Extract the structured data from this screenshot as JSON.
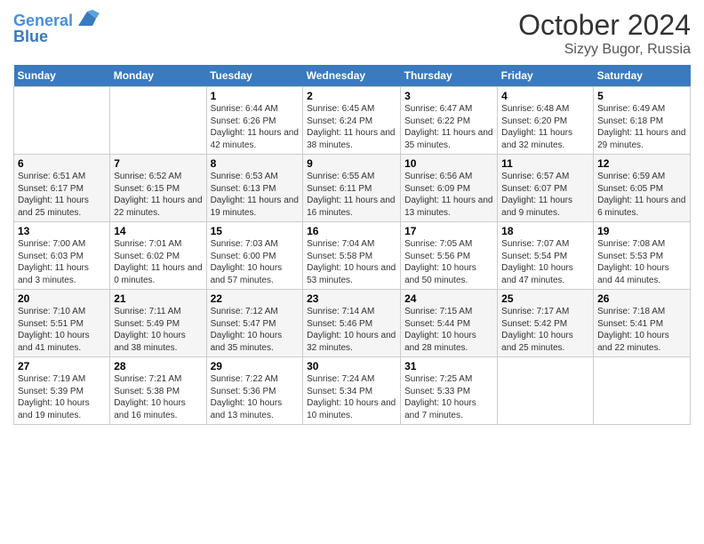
{
  "header": {
    "logo_line1": "General",
    "logo_line2": "Blue",
    "month": "October 2024",
    "location": "Sizyy Bugor, Russia"
  },
  "weekdays": [
    "Sunday",
    "Monday",
    "Tuesday",
    "Wednesday",
    "Thursday",
    "Friday",
    "Saturday"
  ],
  "weeks": [
    [
      {
        "day": "",
        "info": ""
      },
      {
        "day": "",
        "info": ""
      },
      {
        "day": "1",
        "info": "Sunrise: 6:44 AM\nSunset: 6:26 PM\nDaylight: 11 hours and 42 minutes."
      },
      {
        "day": "2",
        "info": "Sunrise: 6:45 AM\nSunset: 6:24 PM\nDaylight: 11 hours and 38 minutes."
      },
      {
        "day": "3",
        "info": "Sunrise: 6:47 AM\nSunset: 6:22 PM\nDaylight: 11 hours and 35 minutes."
      },
      {
        "day": "4",
        "info": "Sunrise: 6:48 AM\nSunset: 6:20 PM\nDaylight: 11 hours and 32 minutes."
      },
      {
        "day": "5",
        "info": "Sunrise: 6:49 AM\nSunset: 6:18 PM\nDaylight: 11 hours and 29 minutes."
      }
    ],
    [
      {
        "day": "6",
        "info": "Sunrise: 6:51 AM\nSunset: 6:17 PM\nDaylight: 11 hours and 25 minutes."
      },
      {
        "day": "7",
        "info": "Sunrise: 6:52 AM\nSunset: 6:15 PM\nDaylight: 11 hours and 22 minutes."
      },
      {
        "day": "8",
        "info": "Sunrise: 6:53 AM\nSunset: 6:13 PM\nDaylight: 11 hours and 19 minutes."
      },
      {
        "day": "9",
        "info": "Sunrise: 6:55 AM\nSunset: 6:11 PM\nDaylight: 11 hours and 16 minutes."
      },
      {
        "day": "10",
        "info": "Sunrise: 6:56 AM\nSunset: 6:09 PM\nDaylight: 11 hours and 13 minutes."
      },
      {
        "day": "11",
        "info": "Sunrise: 6:57 AM\nSunset: 6:07 PM\nDaylight: 11 hours and 9 minutes."
      },
      {
        "day": "12",
        "info": "Sunrise: 6:59 AM\nSunset: 6:05 PM\nDaylight: 11 hours and 6 minutes."
      }
    ],
    [
      {
        "day": "13",
        "info": "Sunrise: 7:00 AM\nSunset: 6:03 PM\nDaylight: 11 hours and 3 minutes."
      },
      {
        "day": "14",
        "info": "Sunrise: 7:01 AM\nSunset: 6:02 PM\nDaylight: 11 hours and 0 minutes."
      },
      {
        "day": "15",
        "info": "Sunrise: 7:03 AM\nSunset: 6:00 PM\nDaylight: 10 hours and 57 minutes."
      },
      {
        "day": "16",
        "info": "Sunrise: 7:04 AM\nSunset: 5:58 PM\nDaylight: 10 hours and 53 minutes."
      },
      {
        "day": "17",
        "info": "Sunrise: 7:05 AM\nSunset: 5:56 PM\nDaylight: 10 hours and 50 minutes."
      },
      {
        "day": "18",
        "info": "Sunrise: 7:07 AM\nSunset: 5:54 PM\nDaylight: 10 hours and 47 minutes."
      },
      {
        "day": "19",
        "info": "Sunrise: 7:08 AM\nSunset: 5:53 PM\nDaylight: 10 hours and 44 minutes."
      }
    ],
    [
      {
        "day": "20",
        "info": "Sunrise: 7:10 AM\nSunset: 5:51 PM\nDaylight: 10 hours and 41 minutes."
      },
      {
        "day": "21",
        "info": "Sunrise: 7:11 AM\nSunset: 5:49 PM\nDaylight: 10 hours and 38 minutes."
      },
      {
        "day": "22",
        "info": "Sunrise: 7:12 AM\nSunset: 5:47 PM\nDaylight: 10 hours and 35 minutes."
      },
      {
        "day": "23",
        "info": "Sunrise: 7:14 AM\nSunset: 5:46 PM\nDaylight: 10 hours and 32 minutes."
      },
      {
        "day": "24",
        "info": "Sunrise: 7:15 AM\nSunset: 5:44 PM\nDaylight: 10 hours and 28 minutes."
      },
      {
        "day": "25",
        "info": "Sunrise: 7:17 AM\nSunset: 5:42 PM\nDaylight: 10 hours and 25 minutes."
      },
      {
        "day": "26",
        "info": "Sunrise: 7:18 AM\nSunset: 5:41 PM\nDaylight: 10 hours and 22 minutes."
      }
    ],
    [
      {
        "day": "27",
        "info": "Sunrise: 7:19 AM\nSunset: 5:39 PM\nDaylight: 10 hours and 19 minutes."
      },
      {
        "day": "28",
        "info": "Sunrise: 7:21 AM\nSunset: 5:38 PM\nDaylight: 10 hours and 16 minutes."
      },
      {
        "day": "29",
        "info": "Sunrise: 7:22 AM\nSunset: 5:36 PM\nDaylight: 10 hours and 13 minutes."
      },
      {
        "day": "30",
        "info": "Sunrise: 7:24 AM\nSunset: 5:34 PM\nDaylight: 10 hours and 10 minutes."
      },
      {
        "day": "31",
        "info": "Sunrise: 7:25 AM\nSunset: 5:33 PM\nDaylight: 10 hours and 7 minutes."
      },
      {
        "day": "",
        "info": ""
      },
      {
        "day": "",
        "info": ""
      }
    ]
  ]
}
